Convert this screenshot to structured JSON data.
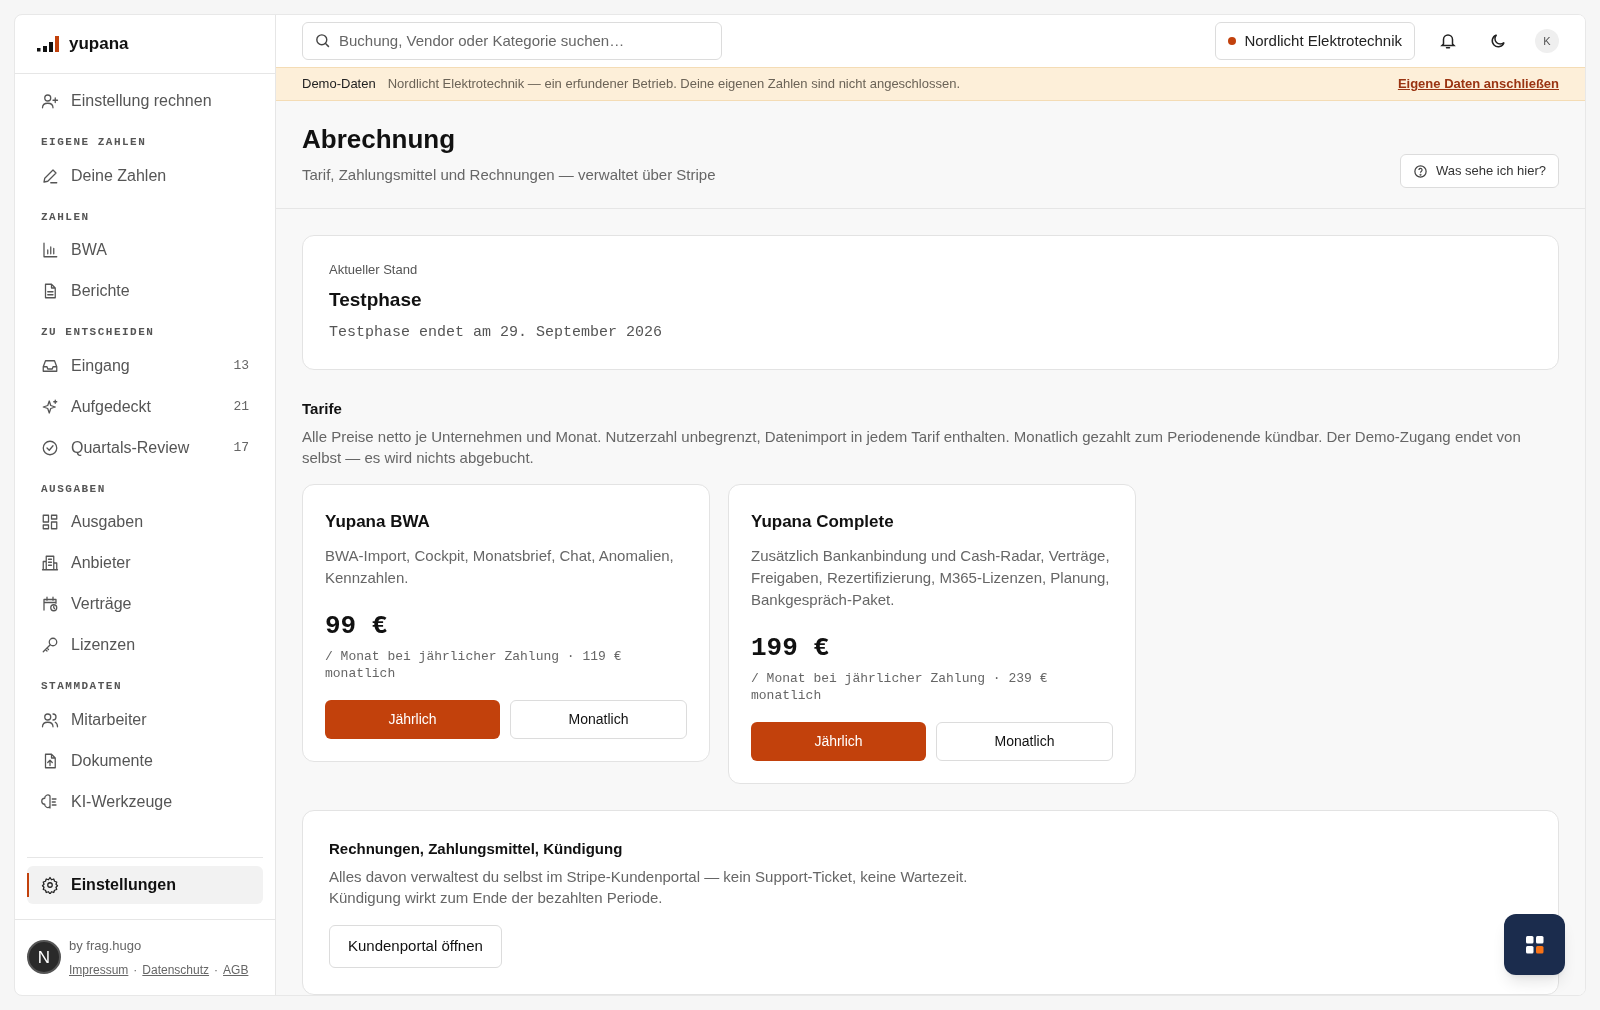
{
  "brand": "yupana",
  "sidebar": {
    "sections": [
      {
        "items": [
          {
            "label": "Einstellung rechnen",
            "selected": false
          }
        ]
      },
      {
        "heading": "EIGENE ZAHLEN",
        "items": [
          {
            "label": "Deine Zahlen",
            "selected": false
          }
        ]
      },
      {
        "heading": "ZAHLEN",
        "items": [
          {
            "label": "BWA",
            "selected": false
          },
          {
            "label": "Berichte",
            "selected": false
          }
        ]
      },
      {
        "heading": "ZU ENTSCHEIDEN",
        "items": [
          {
            "label": "Eingang",
            "count": "13",
            "selected": false
          },
          {
            "label": "Aufgedeckt",
            "count": "21",
            "selected": false
          },
          {
            "label": "Quartals-Review",
            "count": "17",
            "selected": false
          }
        ]
      },
      {
        "heading": "AUSGABEN",
        "items": [
          {
            "label": "Ausgaben",
            "selected": false
          },
          {
            "label": "Anbieter",
            "selected": false
          },
          {
            "label": "Verträge",
            "selected": false
          },
          {
            "label": "Lizenzen",
            "selected": false
          }
        ]
      },
      {
        "heading": "STAMMDATEN",
        "items": [
          {
            "label": "Mitarbeiter",
            "selected": false
          },
          {
            "label": "Dokumente",
            "selected": false
          },
          {
            "label": "KI-Werkzeuge",
            "selected": false
          }
        ]
      }
    ],
    "settings": {
      "label": "Einstellungen",
      "selected": true
    },
    "footer": {
      "credit": "by frag.hugo",
      "links": [
        "Impressum",
        "Datenschutz",
        "AGB"
      ],
      "separators": [
        "·",
        "·"
      ],
      "badge": "N"
    }
  },
  "topbar": {
    "search_placeholder": "Buchung, Vendor oder Kategorie suchen…",
    "company": "Nordlicht Elektrotechnik",
    "avatar": "K"
  },
  "banner": {
    "label": "Demo-Daten",
    "text": "Nordlicht Elektrotechnik — ein erfundener Betrieb. Deine eigenen Zahlen sind nicht angeschlossen.",
    "link": "Eigene Daten anschließen"
  },
  "page": {
    "title": "Abrechnung",
    "subtitle": "Tarif, Zahlungsmittel und Rechnungen — verwaltet über Stripe",
    "help": "Was sehe ich hier?"
  },
  "status": {
    "label": "Aktueller Stand",
    "title": "Testphase",
    "detail": "Testphase endet am 29. September 2026"
  },
  "tariffs": {
    "title": "Tarife",
    "text": "Alle Preise netto je Unternehmen und Monat. Nutzerzahl unbegrenzt, Datenimport in jedem Tarif enthalten. Monatlich gezahlt zum Periodenende kündbar. Der Demo-Zugang endet von selbst — es wird nichts abgebucht.",
    "plans": [
      {
        "name": "Yupana BWA",
        "description": "BWA-Import, Cockpit, Monatsbrief, Chat, Anomalien, Kennzahlen.",
        "price": "99 €",
        "note": "/ Monat bei jährlicher Zahlung · 119 € monatlich",
        "options": [
          {
            "label": "Jährlich",
            "selected": true
          },
          {
            "label": "Monatlich",
            "selected": false
          }
        ]
      },
      {
        "name": "Yupana Complete",
        "description": "Zusätzlich Bankanbindung und Cash-Radar, Verträge, Freigaben, Rezertifizierung, M365-Lizenzen, Planung, Bankgespräch-Paket.",
        "price": "199 €",
        "note": "/ Monat bei jährlicher Zahlung · 239 € monatlich",
        "options": [
          {
            "label": "Jährlich",
            "selected": true
          },
          {
            "label": "Monatlich",
            "selected": false
          }
        ]
      }
    ]
  },
  "portal": {
    "title": "Rechnungen, Zahlungsmittel, Kündigung",
    "lines": [
      "Alles davon verwaltest du selbst im Stripe-Kundenportal — kein Support-Ticket, keine Wartezeit.",
      "Kündigung wirkt zum Ende der bezahlten Periode."
    ],
    "button": "Kundenportal öffnen"
  }
}
